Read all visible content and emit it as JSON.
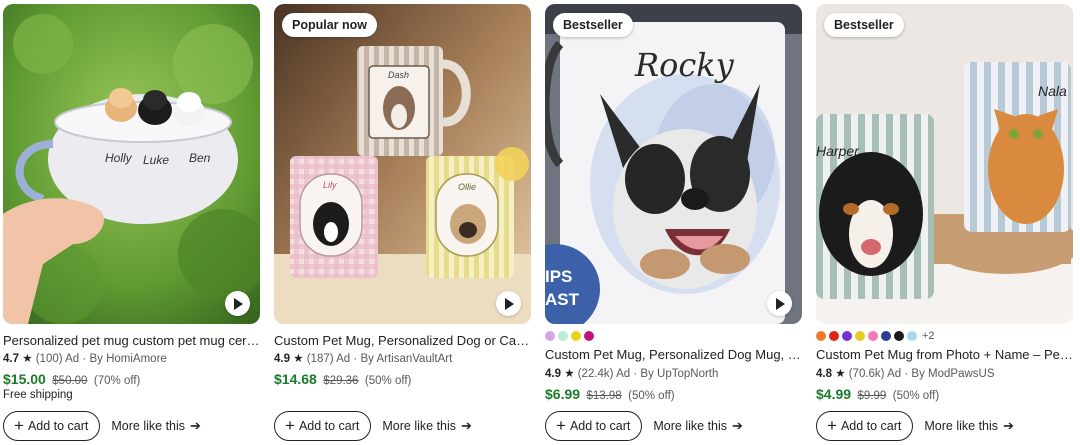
{
  "listings": [
    {
      "badge": "",
      "title": "Personalized pet mug custom pet mug ceramic pee...",
      "rating": "4.7",
      "reviews": "(100)",
      "ad": "Ad",
      "by": "By HomiAmore",
      "price": "$15.00",
      "original_price": "$50.00",
      "discount": "(70% off)",
      "shipping": "Free shipping",
      "image_text": [
        "Holly",
        "Luke",
        "Ben"
      ],
      "colors": [],
      "more_colors": ""
    },
    {
      "badge": "Popular now",
      "title": "Custom Pet Mug, Personalized Dog or Cat Mug, M...",
      "rating": "4.9",
      "reviews": "(187)",
      "ad": "Ad",
      "by": "By ArtisanVaultArt",
      "price": "$14.68",
      "original_price": "$29.36",
      "discount": "(50% off)",
      "shipping": "",
      "image_text": [
        "Dash",
        "Lily",
        "Ollie"
      ],
      "colors": [],
      "more_colors": ""
    },
    {
      "badge": "Bestseller",
      "title": "Custom Pet Mug, Personalized Dog Mug, Watercol...",
      "rating": "4.9",
      "reviews": "(22.4k)",
      "ad": "Ad",
      "by": "By UpTopNorth",
      "price": "$6.99",
      "original_price": "$13.98",
      "discount": "(50% off)",
      "shipping": "",
      "image_text": [
        "Rocky",
        "IPS",
        "AST"
      ],
      "colors": [
        "#d9a3e8",
        "#b9ecd6",
        "#e8d21a",
        "#c0147a"
      ],
      "more_colors": ""
    },
    {
      "badge": "Bestseller",
      "title": "Custom Pet Mug from Photo + Name – Personalize...",
      "rating": "4.8",
      "reviews": "(70.6k)",
      "ad": "Ad",
      "by": "By ModPawsUS",
      "price": "$4.99",
      "original_price": "$9.99",
      "discount": "(50% off)",
      "shipping": "",
      "image_text": [
        "Harper",
        "Nala"
      ],
      "colors": [
        "#f07a2a",
        "#e0241b",
        "#7a2fd1",
        "#e2cf24",
        "#f37ab4",
        "#2a3f8f",
        "#1c1c1c",
        "#a8d8f0"
      ],
      "more_colors": "+2"
    }
  ],
  "labels": {
    "add_to_cart": "Add to cart",
    "more_like_this": "More like this"
  },
  "icons": [
    "plus-icon",
    "arrow-right-icon",
    "play-icon",
    "star-icon"
  ]
}
